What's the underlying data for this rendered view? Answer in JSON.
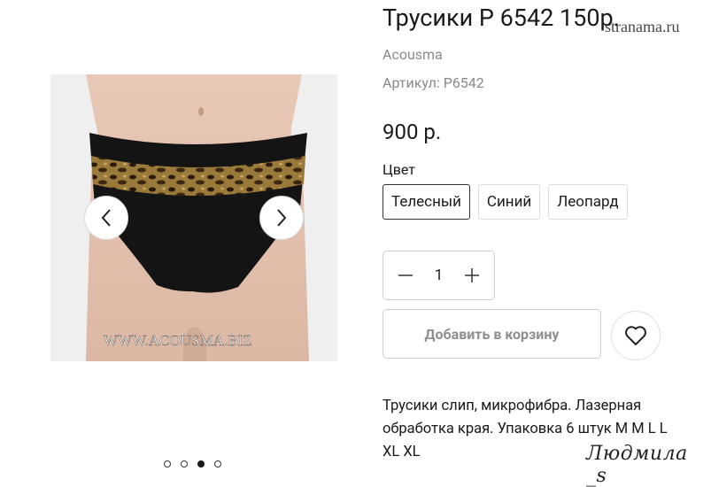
{
  "product": {
    "title": "Трусики Р 6542 150р.",
    "brand": "Acousma",
    "sku": "Артикул: P6542",
    "price": "900 р."
  },
  "gallery": {
    "image_watermark": "WWW.ACOUSMA.BIZ",
    "prev_icon": "chevron-left-icon",
    "next_icon": "chevron-right-icon",
    "total_slides": 4,
    "active_slide": 3
  },
  "color": {
    "label": "Цвет",
    "options": [
      "Телесный",
      "Синий",
      "Леопард"
    ],
    "selected": "Телесный"
  },
  "quantity": {
    "value": "1",
    "minus_icon": "minus-icon",
    "plus_icon": "plus-icon"
  },
  "actions": {
    "add_to_cart": "Добавить в корзину",
    "wishlist_icon": "heart-icon"
  },
  "description": "Трусики слип, микрофибра. Лазерная обработка края. Упаковка 6 штук M M L L XL XL",
  "watermarks": {
    "site": "stranama.ru",
    "signature": "Людмила _s"
  },
  "colors": {
    "text": "#1a1a1a",
    "muted": "#8a8a8a",
    "border": "#cfcfcf",
    "image_bg": "#efefef",
    "garment": "#141414",
    "leopard": "#8a6a2a"
  }
}
